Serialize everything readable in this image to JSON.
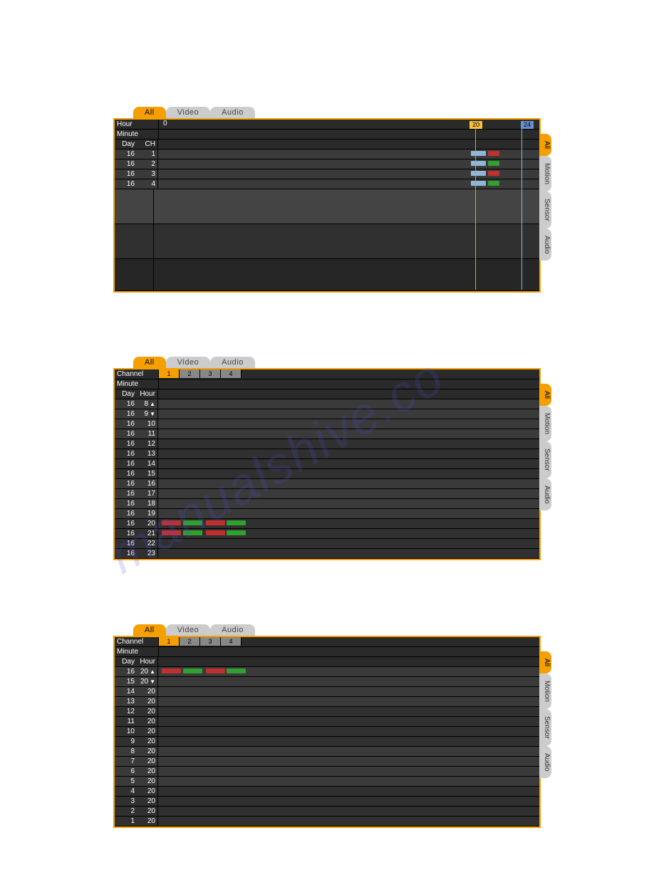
{
  "panel1": {
    "topTabs": [
      "All",
      "Video",
      "Audio"
    ],
    "sideTabs": [
      "All",
      "Motion",
      "Sensor",
      "Audio"
    ],
    "labels": {
      "hour": "Hour",
      "minute": "Minute",
      "day": "Day",
      "ch": "CH",
      "zero": "0",
      "h20": "20",
      "h24": "24"
    },
    "rows": [
      {
        "day": "16",
        "ch": "1"
      },
      {
        "day": "16",
        "ch": "2"
      },
      {
        "day": "16",
        "ch": "3"
      },
      {
        "day": "16",
        "ch": "4"
      }
    ]
  },
  "panel2": {
    "topTabs": [
      "All",
      "Video",
      "Audio"
    ],
    "sideTabs": [
      "All",
      "Motion",
      "Sensor",
      "Audio"
    ],
    "labels": {
      "channel": "Channel",
      "minute": "Minute",
      "day": "Day",
      "hour": "Hour"
    },
    "channels": [
      "1",
      "2",
      "3",
      "4"
    ],
    "rows": [
      {
        "day": "16",
        "hour": "8",
        "arrow": "up"
      },
      {
        "day": "16",
        "hour": "9",
        "arrow": "down"
      },
      {
        "day": "16",
        "hour": "10"
      },
      {
        "day": "16",
        "hour": "11"
      },
      {
        "day": "16",
        "hour": "12"
      },
      {
        "day": "16",
        "hour": "13"
      },
      {
        "day": "16",
        "hour": "14"
      },
      {
        "day": "16",
        "hour": "15"
      },
      {
        "day": "16",
        "hour": "16"
      },
      {
        "day": "16",
        "hour": "17"
      },
      {
        "day": "16",
        "hour": "18"
      },
      {
        "day": "16",
        "hour": "19"
      },
      {
        "day": "16",
        "hour": "20",
        "bars": true
      },
      {
        "day": "16",
        "hour": "21",
        "bars": true
      },
      {
        "day": "16",
        "hour": "22"
      },
      {
        "day": "16",
        "hour": "23"
      }
    ]
  },
  "panel3": {
    "topTabs": [
      "All",
      "Video",
      "Audio"
    ],
    "sideTabs": [
      "All",
      "Motion",
      "Sensor",
      "Audio"
    ],
    "labels": {
      "channel": "Channel",
      "minute": "Minute",
      "day": "Day",
      "hour": "Hour"
    },
    "channels": [
      "1",
      "2",
      "3",
      "4"
    ],
    "rows": [
      {
        "day": "16",
        "hour": "20",
        "arrow": "up",
        "bars": true
      },
      {
        "day": "15",
        "hour": "20",
        "arrow": "down"
      },
      {
        "day": "14",
        "hour": "20"
      },
      {
        "day": "13",
        "hour": "20"
      },
      {
        "day": "12",
        "hour": "20"
      },
      {
        "day": "11",
        "hour": "20"
      },
      {
        "day": "10",
        "hour": "20"
      },
      {
        "day": "9",
        "hour": "20"
      },
      {
        "day": "8",
        "hour": "20"
      },
      {
        "day": "7",
        "hour": "20"
      },
      {
        "day": "6",
        "hour": "20"
      },
      {
        "day": "5",
        "hour": "20"
      },
      {
        "day": "4",
        "hour": "20"
      },
      {
        "day": "3",
        "hour": "20"
      },
      {
        "day": "2",
        "hour": "20"
      },
      {
        "day": "1",
        "hour": "20"
      }
    ]
  }
}
